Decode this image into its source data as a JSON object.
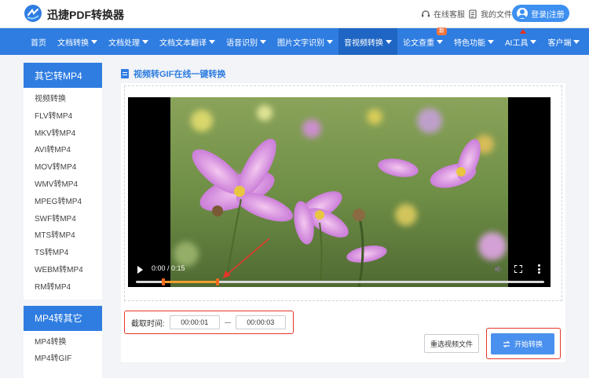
{
  "header": {
    "brand": "迅捷PDF转换器",
    "support_label": "在线客服",
    "files_label": "我的文件",
    "login_label": "登录|注册"
  },
  "nav": {
    "items": [
      {
        "label": "首页",
        "dropdown": false
      },
      {
        "label": "文档转换",
        "dropdown": true
      },
      {
        "label": "文档处理",
        "dropdown": true
      },
      {
        "label": "文档文本翻译",
        "dropdown": true
      },
      {
        "label": "语音识别",
        "dropdown": true
      },
      {
        "label": "图片文字识别",
        "dropdown": true
      },
      {
        "label": "音视频转换",
        "dropdown": true,
        "active": true
      },
      {
        "label": "论文查重",
        "dropdown": true,
        "badge": "新"
      },
      {
        "label": "特色功能",
        "dropdown": true
      },
      {
        "label": "AI工具",
        "dropdown": true
      },
      {
        "label": "客户端",
        "dropdown": true
      }
    ]
  },
  "sidebar": {
    "section1_title": "其它转MP4",
    "section1_items": [
      "视频转换",
      "FLV转MP4",
      "MKV转MP4",
      "AVI转MP4",
      "MOV转MP4",
      "WMV转MP4",
      "MPEG转MP4",
      "SWF转MP4",
      "MTS转MP4",
      "TS转MP4",
      "WEBM转MP4",
      "RM转MP4"
    ],
    "section2_title": "MP4转其它",
    "section2_items": [
      "MP4转换",
      "MP4转GIF"
    ]
  },
  "main": {
    "title": "视频转GIF在线一键转换",
    "video": {
      "time_display": "0:00 / 0:15",
      "progress_start_fraction": 0.067,
      "progress_end_fraction": 0.2
    },
    "clip": {
      "label": "截取时间:",
      "start_value": "00:00:01",
      "end_value": "00:00:03"
    },
    "reselect_label": "重选视频文件",
    "start_label": "开始转换"
  },
  "colors": {
    "accent": "#2f7de1",
    "highlight_red": "#e5372a"
  }
}
